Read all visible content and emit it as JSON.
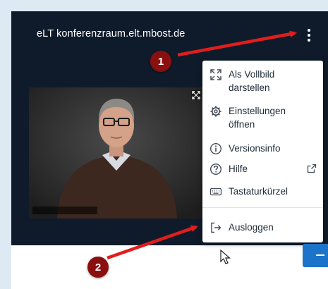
{
  "header": {
    "room_title": "eLT konferenzraum.elt.mbost.de"
  },
  "menu": {
    "items": [
      {
        "label": "Als Vollbild darstellen",
        "icon": "fullscreen-icon"
      },
      {
        "label": "Einstellungen öffnen",
        "icon": "gear-icon"
      },
      {
        "label": "Versionsinfo",
        "icon": "info-icon"
      },
      {
        "label": "Hilfe",
        "icon": "help-icon"
      },
      {
        "label": "Tastaturkürzel",
        "icon": "keyboard-icon"
      },
      {
        "label": "Ausloggen",
        "icon": "logout-icon"
      }
    ]
  },
  "annotations": {
    "badge_1": "1",
    "badge_2": "2"
  },
  "colors": {
    "panel_bg": "#0f1b2a",
    "annotation_red": "#e11d1d",
    "badge_bg": "#8a1010",
    "accent_blue": "#1b74c9"
  }
}
